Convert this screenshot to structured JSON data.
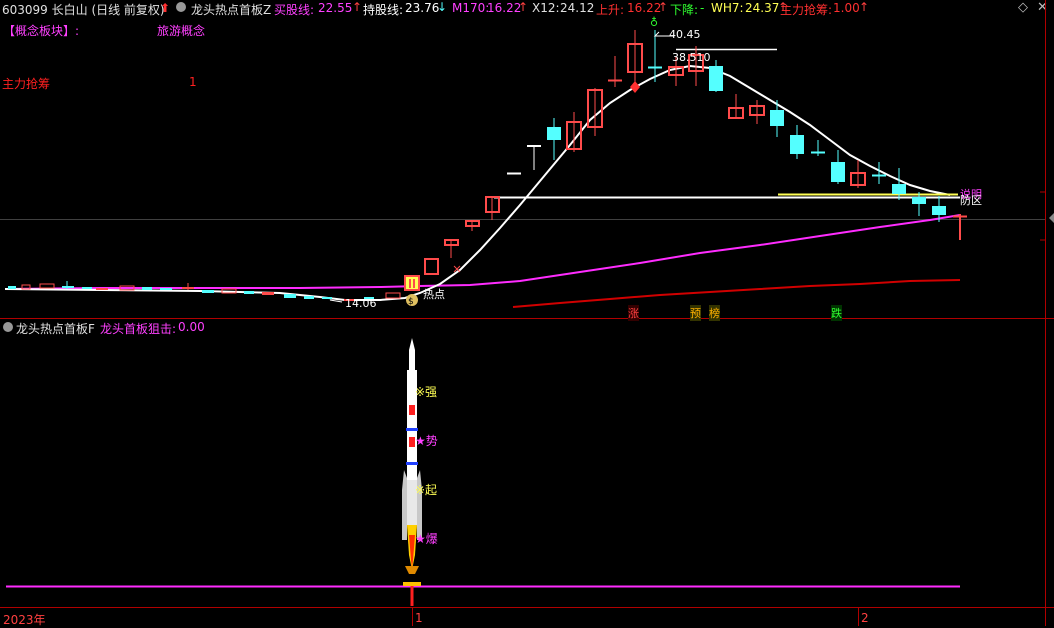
{
  "header": {
    "stock": "603099 长白山 (日线 前复权)",
    "indicator_name": "龙头热点首板Z",
    "buy_label": "买股线:",
    "buy_value": "22.55",
    "hold_label": "持股线:",
    "hold_value": "23.76",
    "m170_label": "M170:",
    "m170_value": "16.22",
    "x12_label": "X12:",
    "x12_value": "24.12",
    "up_label": "上升:",
    "up_value": "16.22",
    "down_label": "下降:",
    "down_value": "-",
    "wh7_label": "WH7:",
    "wh7_value": "24.37",
    "zl_label": "主力抢筹:",
    "zl_value": "1.00"
  },
  "info": {
    "concept_label": "【概念板块】:",
    "concept_value": "旅游概念",
    "zl_label": "主力抢筹",
    "zl_value": "1"
  },
  "main_chart": {
    "high_label": "40.45",
    "price_label": "38.510",
    "low_label": "14.06",
    "hot_label": "热点",
    "right_tag1": "说明",
    "right_tag2": "防区",
    "markers": [
      "涨",
      "预",
      "榜",
      "跌"
    ]
  },
  "sub_panel": {
    "title": "龙头热点首板F",
    "value_label": "龙头首板狙击:",
    "value": "0.00",
    "rocket_labels": [
      "※强",
      "★势",
      "※起",
      "★爆"
    ]
  },
  "time_axis": {
    "labels": [
      "2023年",
      "1",
      "2"
    ]
  },
  "colors": {
    "up": "#ff4b4b",
    "down": "#54ffff",
    "ma_white": "#ffffff",
    "ma_magenta": "#ff2cff",
    "ma_red": "#e00000",
    "yellow": "#ffff54"
  }
}
